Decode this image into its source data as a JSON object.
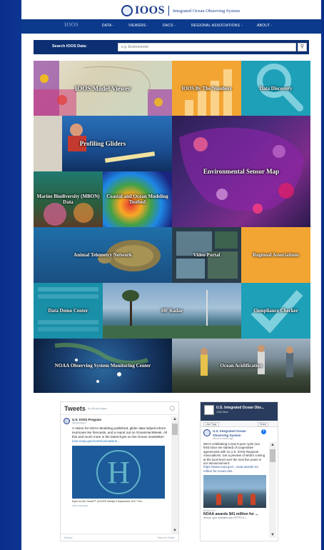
{
  "header": {
    "logo_text": "IOOS",
    "tagline": "Integrated Ocean Observing System",
    "nav_logo": "IOOS",
    "nav": [
      "DATA -",
      "VIEWERS -",
      "DACS -",
      "REGIONAL ASSOCIATIONS -",
      "ABOUT -"
    ]
  },
  "search": {
    "label": "Search IOOS Data:",
    "placeholder": "e.g. Environment"
  },
  "tiles": [
    {
      "label": "IOOS Model Viewer"
    },
    {
      "label": "IOOS By The Numbers"
    },
    {
      "label": "Data Discovery"
    },
    {
      "label": "Profiling Gliders"
    },
    {
      "label": "Environmental Sensor Map"
    },
    {
      "label": "Marine Biodiversity (MBON) Data"
    },
    {
      "label": "Coastal and Ocean Modeling Testbed"
    },
    {
      "label": "Animal Telemetry Network"
    },
    {
      "label": "Video Portal"
    },
    {
      "label": "Regional Associations"
    },
    {
      "label": "Data Demo Center"
    },
    {
      "label": "HF Radar"
    },
    {
      "label": "Compliance Checker"
    },
    {
      "label": "NOAA Observing System Monitoring Center"
    },
    {
      "label": "Ocean Acidification"
    }
  ],
  "twitter": {
    "title": "Tweets",
    "by": "by @usioosgov",
    "user_name": "U.S. IOOS Program",
    "user_handle": "@usioosgov",
    "text": "A Vision for NOAA Modeling published, glider data helped inform Hurricane Ike forecasts, and a report out on OceanHackWeek. All this and much more in the latest Eyes on the Ocean newsletter!",
    "link": "ioos.noaa.gov/communications...",
    "card_caption": "Eyes on the Ocean™ (IOOS® weekly 6 September 2017 The...",
    "card_source": "ioos.noaa.gov",
    "footer_left": "Embed",
    "footer_right": "View on Twitter"
  },
  "facebook": {
    "page_title": "U.S. Integrated Ocean Obs...",
    "likes": "2,823 likes",
    "like_btn": "Like Page",
    "share_btn": "Share",
    "post_name": "U.S. Integrated Ocean Observing System",
    "post_time": "about a month ago",
    "post_text": "We're celebrating a new 5-year cycle (our third since we started) of cooperative agreements with 11 U.S. IOOS Regional Associations. Get a preview of what's coming at the local level over the next five years in our announcement:",
    "post_link": "https://www.noaa.gov/...noaa-awards-41-million-for-ocean-obs...",
    "domain": "NOAA.GOV",
    "headline": "NOAA awards $41 million for ...",
    "sub": "Secure .gov websites use HTTPS A l..."
  }
}
